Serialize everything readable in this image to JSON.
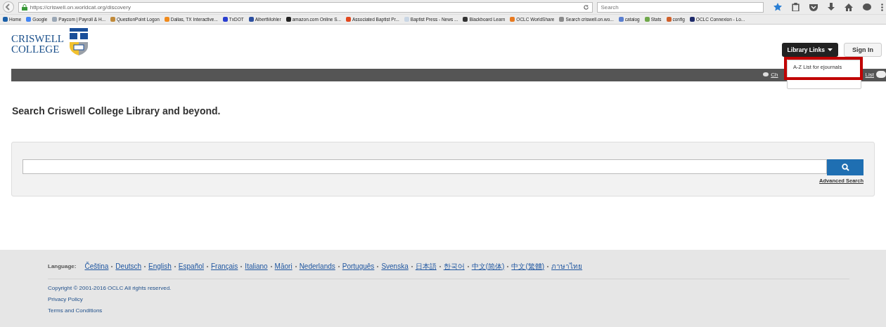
{
  "browser": {
    "url": "https://criswell.on.worldcat.org/discovery",
    "search_placeholder": "Search",
    "bookmarks": [
      {
        "label": "Home",
        "color": "#1a5fa8"
      },
      {
        "label": "Google",
        "color": "#4285f4"
      },
      {
        "label": "Paycom | Payroll & H...",
        "color": "#9aa7b5"
      },
      {
        "label": "QuestionPoint Logon",
        "color": "#c08a3a"
      },
      {
        "label": "Dallas, TX Interactive...",
        "color": "#f08a1c"
      },
      {
        "label": "TxDOT",
        "color": "#2a3fd0"
      },
      {
        "label": "AlbertMohler",
        "color": "#2c4fa0"
      },
      {
        "label": "amazon.com Online S...",
        "color": "#222222"
      },
      {
        "label": "Associated Baptist Pr...",
        "color": "#e2471d"
      },
      {
        "label": "Baptist Press - News ...",
        "color": "#c9d6e4"
      },
      {
        "label": "Blackboard Learn",
        "color": "#333333"
      },
      {
        "label": "OCLC WorldShare",
        "color": "#e87a20"
      },
      {
        "label": "Search criswell.on.wo...",
        "color": "#8a8a8a"
      },
      {
        "label": "catalog",
        "color": "#5a7fd0"
      },
      {
        "label": "Stats",
        "color": "#6fa84a"
      },
      {
        "label": "config",
        "color": "#d0602a"
      },
      {
        "label": "OCLC Connexion - Lo...",
        "color": "#1e2a6a"
      }
    ]
  },
  "header": {
    "logo_line1": "CRISWELL",
    "logo_line2": "COLLEGE",
    "library_links": "Library Links",
    "sign_in": "Sign In",
    "menu_items": [
      "A-Z List for ejournals"
    ],
    "bar_links": [
      "Ch",
      "List"
    ]
  },
  "heading": "Search Criswell College Library and beyond.",
  "search": {
    "advanced": "Advanced Search"
  },
  "footer": {
    "language_label": "Language:",
    "languages": [
      "Čeština",
      "Deutsch",
      "English",
      "Español",
      "Français",
      "Italiano",
      "Māori",
      "Nederlands",
      "Português",
      "Svenska",
      "日本語",
      "한국어",
      "中文(简体)",
      "中文(繁體)",
      "ภาษาไทย"
    ],
    "copyright": "Copyright © 2001-2016 OCLC All rights reserved.",
    "links": [
      "Privacy Policy",
      "Terms and Conditions"
    ]
  }
}
